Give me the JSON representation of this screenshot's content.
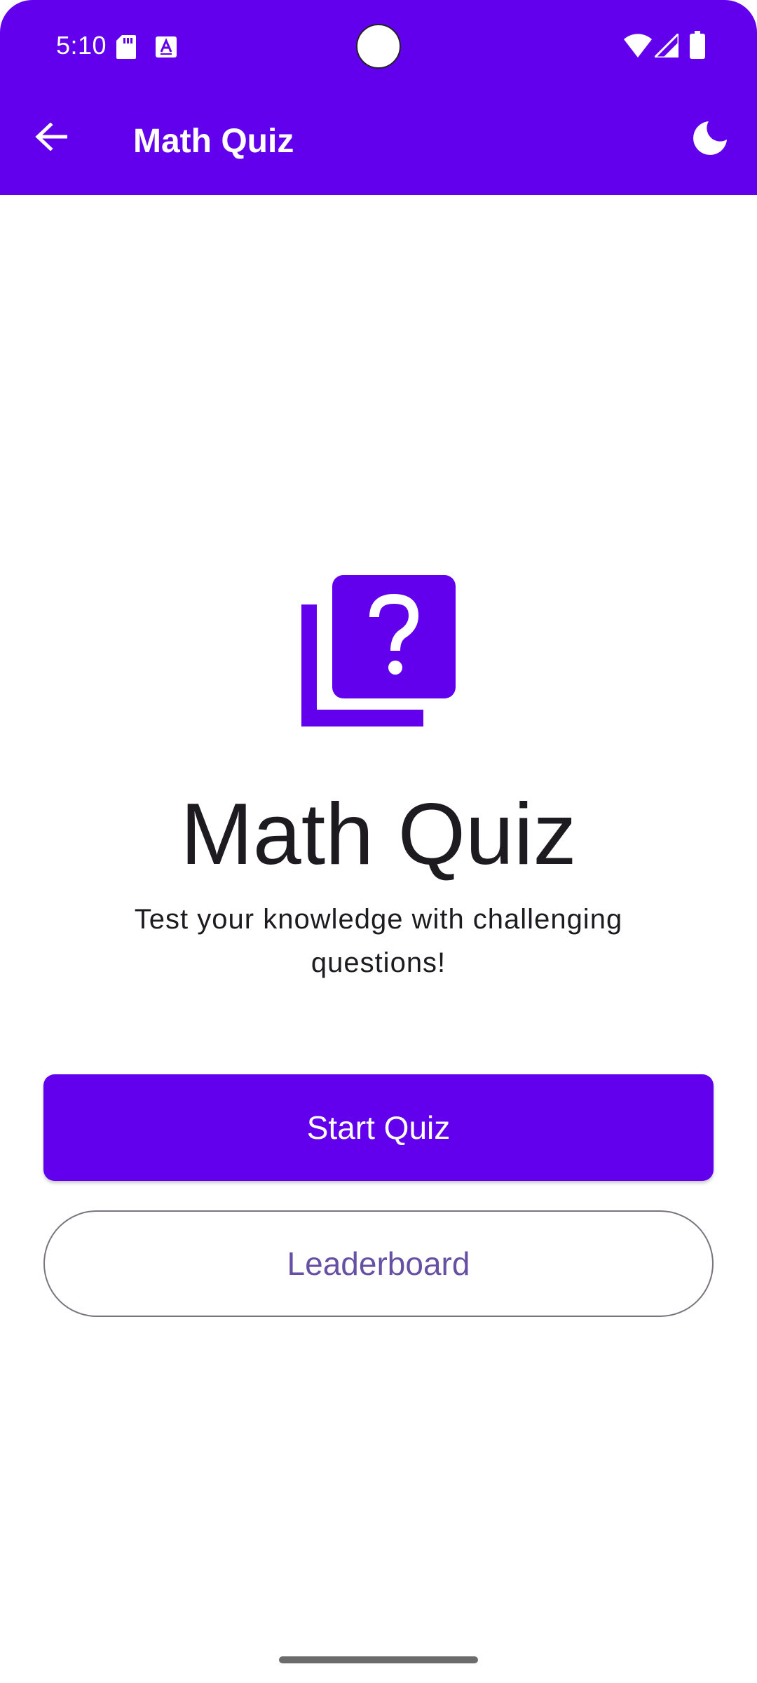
{
  "status_bar": {
    "time": "5:10",
    "icons": [
      "sd-card-icon",
      "text-a-icon",
      "wifi-icon",
      "signal-icon",
      "battery-icon"
    ]
  },
  "app_bar": {
    "title": "Math Quiz",
    "back_icon": "arrow-back-icon",
    "theme_icon": "dark-mode-moon-icon"
  },
  "hero": {
    "icon": "quiz-question-icon",
    "title": "Math Quiz",
    "subtitle": "Test your knowledge with challenging questions!"
  },
  "actions": {
    "start_label": "Start Quiz",
    "leaderboard_label": "Leaderboard"
  },
  "colors": {
    "primary": "#6200EE",
    "outline_text": "#6750A4",
    "outline_border": "#79747E",
    "on_surface": "#1d1b20"
  }
}
